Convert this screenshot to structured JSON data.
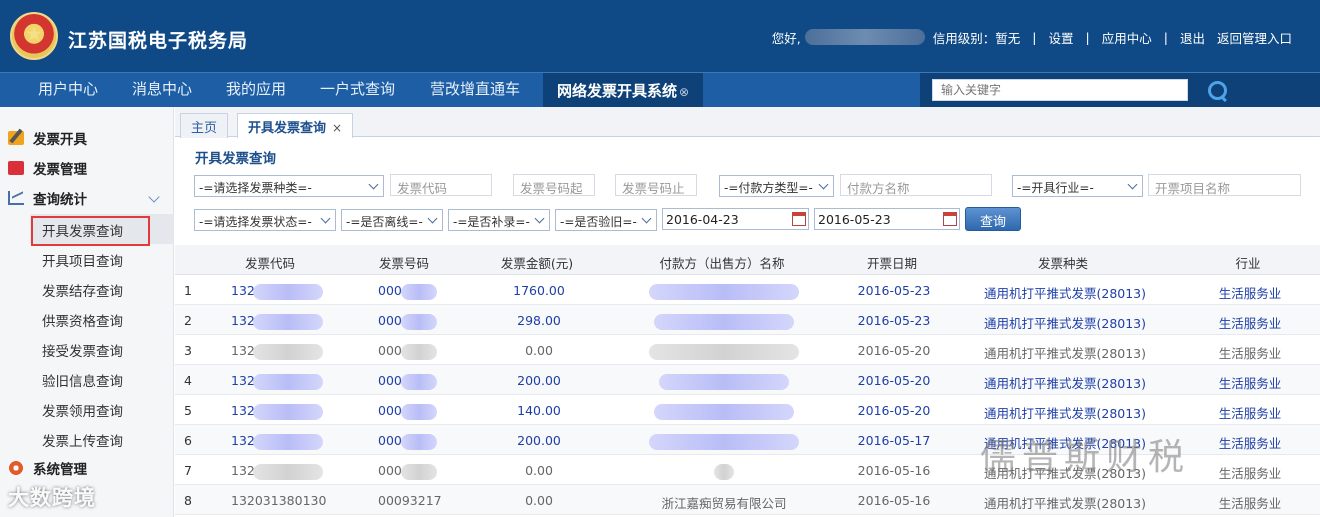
{
  "header": {
    "site_title": "江苏国税电子税务局",
    "greeting": "您好,",
    "credit_level": "信用级别：暂无",
    "links": [
      "设置",
      "应用中心",
      "退出",
      "返回管理入口"
    ],
    "separator": "|"
  },
  "topnav": {
    "items": [
      "用户中心",
      "消息中心",
      "我的应用",
      "一户式查询",
      "营改增直通车"
    ],
    "active": "网络发票开具系统",
    "active_close": "⊗",
    "search_placeholder": "输入关键字"
  },
  "sidebar": {
    "groups": [
      {
        "label": "发票开具",
        "icon": "pen-icon"
      },
      {
        "label": "发票管理",
        "icon": "folder-icon"
      },
      {
        "label": "查询统计",
        "icon": "chart-icon"
      },
      {
        "label": "系统管理",
        "icon": "gear-icon"
      }
    ],
    "items": [
      "开具发票查询",
      "开具项目查询",
      "发票结存查询",
      "供票资格查询",
      "接受发票查询",
      "验旧信息查询",
      "发票领用查询",
      "发票上传查询"
    ]
  },
  "tabs": {
    "home": "主页",
    "active": "开具发票查询",
    "close": "×"
  },
  "section_title": "开具发票查询",
  "filters": {
    "invoice_type": "-=请选择发票种类=-",
    "invoice_code": "发票代码",
    "invoice_no_start": "发票号码起",
    "invoice_no_end": "发票号码止",
    "payer_type": "-=付款方类型=-",
    "payer_name": "付款方名称",
    "industry": "-=开具行业=-",
    "item_name": "开票项目名称",
    "invoice_status": "-=请选择发票状态=-",
    "offline": "-=是否离线=-",
    "supplement": "-=是否补录=-",
    "verified": "-=是否验旧=-",
    "date_from": "2016-04-23",
    "date_to": "2016-05-23",
    "query_label": "查询"
  },
  "table": {
    "headers": [
      "发票代码",
      "发票号码",
      "发票金额(元)",
      "付款方（出售方）名称",
      "开票日期",
      "发票种类",
      "行业"
    ],
    "rows": [
      {
        "no": "1",
        "code": "1320",
        "number": "000",
        "amount": "1760.00",
        "payer": "",
        "date": "2016-05-23",
        "kind": "通用机打平推式发票(28013)",
        "industry": "生活服务业",
        "style": "blue"
      },
      {
        "no": "2",
        "code": "1320",
        "number": "000",
        "amount": "298.00",
        "payer": "",
        "date": "2016-05-23",
        "kind": "通用机打平推式发票(28013)",
        "industry": "生活服务业",
        "style": "blue"
      },
      {
        "no": "3",
        "code": "1320",
        "number": "0009",
        "amount": "0.00",
        "payer": "",
        "date": "2016-05-20",
        "kind": "通用机打平推式发票(28013)",
        "industry": "生活服务业",
        "style": "gray"
      },
      {
        "no": "4",
        "code": "1320",
        "number": "000",
        "amount": "200.00",
        "payer": "",
        "date": "2016-05-20",
        "kind": "通用机打平推式发票(28013)",
        "industry": "生活服务业",
        "style": "blue"
      },
      {
        "no": "5",
        "code": "1320",
        "number": "000",
        "amount": "140.00",
        "payer": "",
        "date": "2016-05-20",
        "kind": "通用机打平推式发票(28013)",
        "industry": "生活服务业",
        "style": "blue"
      },
      {
        "no": "6",
        "code": "132",
        "number": "000",
        "amount": "200.00",
        "payer": "",
        "date": "2016-05-17",
        "kind": "通用机打平推式发票(28013)",
        "industry": "生活服务业",
        "style": "blue"
      },
      {
        "no": "7",
        "code": "1320",
        "number": "000",
        "amount": "0.00",
        "payer": "",
        "date": "2016-05-16",
        "kind": "通用机打平推式发票(28013)",
        "industry": "生活服务业",
        "style": "gray"
      },
      {
        "no": "8",
        "code": "132031380130",
        "number": "00093217",
        "amount": "0.00",
        "payer": "浙江嘉痴贸易有限公司",
        "date": "2016-05-16",
        "kind": "通用机打平推式发票(28013)",
        "industry": "生活服务业",
        "style": "gray"
      }
    ]
  },
  "watermarks": {
    "left": "大数跨境",
    "right": "儒普斯财税"
  }
}
